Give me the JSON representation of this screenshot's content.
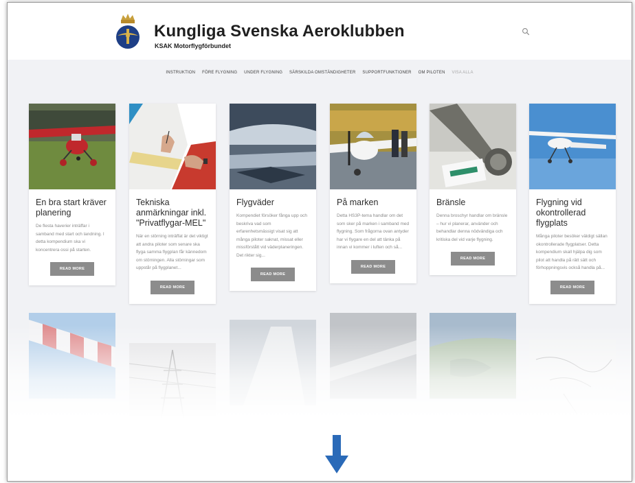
{
  "site": {
    "title": "Kungliga Svenska Aeroklubben",
    "subtitle": "KSAK Motorflygförbundet"
  },
  "nav": {
    "items": [
      "INSTRUKTION",
      "FÖRE FLYGNING",
      "UNDER FLYGNING",
      "SÄRSKILDA OMSTÄNDIGHETER",
      "SUPPORTFUNKTIONER",
      "OM PILOTEN"
    ],
    "view_all": "VISA ALLA"
  },
  "cards": [
    {
      "title": "En bra start kräver planering",
      "excerpt": "De flesta haverier inträffar i samband med start och landning. I detta kompendium ska vi koncentrera ossi på starten.",
      "button": "READ MORE"
    },
    {
      "title": "Tekniska anmärkningar inkl. \"Privatflygar-MEL\"",
      "excerpt": "När en störning inträffat är det viktigt att andra piloter som senare ska flyga samma flygplan får kännedom om störningen. Alla störningar som uppstår på flygplanet...",
      "button": "READ MORE"
    },
    {
      "title": "Flygväder",
      "excerpt": "Kompendiet försöker fånga upp och beskriva vad som erfarenhetsmässigt visat sig att många piloter saknat, missat eller missförstått vid väderplaneringen. Det rikter sig...",
      "button": "READ MORE"
    },
    {
      "title": "På marken",
      "excerpt": "Detta HS3P-tema handlar om det som sker på marken i samband med flygning. Som frågorna ovan antyder har vi flygare en del att tänka på innan vi kommer i luften och så...",
      "button": "READ MORE"
    },
    {
      "title": "Bränsle",
      "excerpt": "Denna broschyr handlar om bränsle – hur vi planerar, använder och behandlar denna nödvändiga och kritiska del vid varje flygning.",
      "button": "READ MORE"
    },
    {
      "title": "Flygning vid okontrollerad flygplats",
      "excerpt": "Många piloter besöker väldigt sällan okontrollerade flygplatser. Detta kompendium skall hjälpa dig som pilot att handla på rätt sätt och förhoppningsvis också handla på...",
      "button": "READ MORE"
    }
  ],
  "colors": {
    "accent": "#2a6ab8",
    "button": "#8c8c8c"
  },
  "icons": {
    "search": "search-icon",
    "scroll": "arrow-down-icon"
  }
}
